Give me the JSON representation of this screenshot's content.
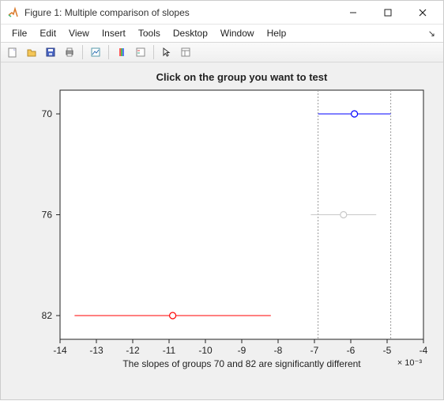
{
  "window": {
    "title": "Figure 1: Multiple comparison of slopes",
    "minimize": "–",
    "maximize": "□",
    "close": "×"
  },
  "menu": {
    "file": "File",
    "edit": "Edit",
    "view": "View",
    "insert": "Insert",
    "tools": "Tools",
    "desktop": "Desktop",
    "window": "Window",
    "help": "Help",
    "dock": "↘"
  },
  "chart_data": {
    "type": "scatter",
    "title": "Click on the group you want to test",
    "message": "The slopes of groups 70 and 82 are significantly different",
    "xlim": [
      -14,
      -4
    ],
    "x_multiplier_label": "× 10⁻³",
    "x_ticks": [
      -14,
      -13,
      -12,
      -11,
      -10,
      -9,
      -8,
      -7,
      -6,
      -5,
      -4
    ],
    "y_categories": [
      "70",
      "76",
      "82"
    ],
    "selected_group": "70",
    "vlines": [
      -6.9,
      -4.9
    ],
    "series": [
      {
        "name": "70",
        "mean": -5.9,
        "low": -6.9,
        "high": -4.9,
        "color": "#0000ff",
        "y": 0
      },
      {
        "name": "76",
        "mean": -6.2,
        "low": -7.1,
        "high": -5.3,
        "color": "#c8c8c8",
        "y": 1
      },
      {
        "name": "82",
        "mean": -10.9,
        "low": -13.6,
        "high": -8.2,
        "color": "#ff0000",
        "y": 2
      }
    ]
  }
}
